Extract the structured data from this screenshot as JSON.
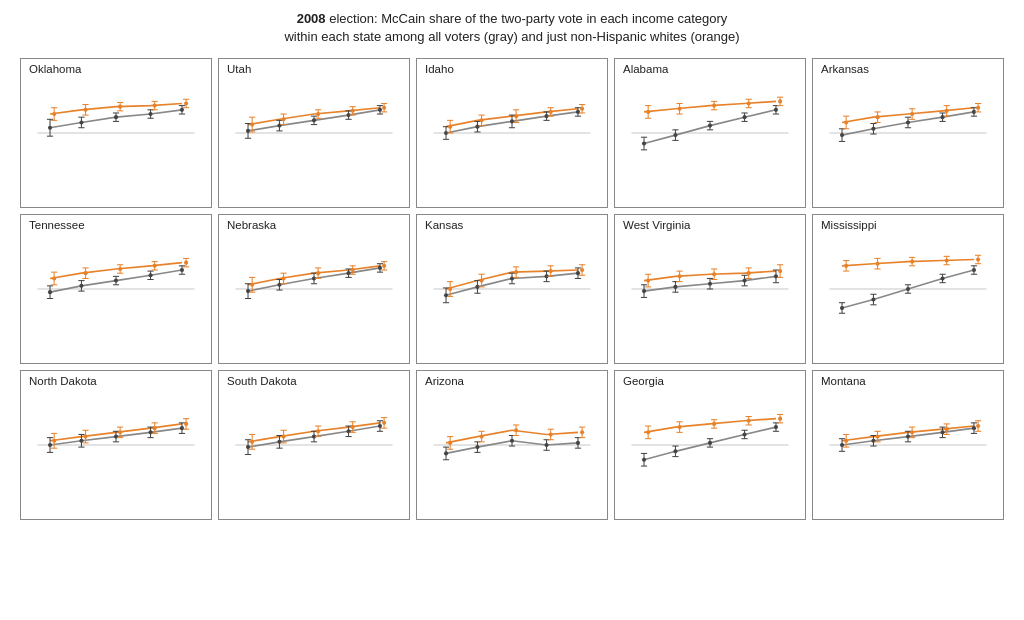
{
  "title": {
    "line1_bold": "2008",
    "line1_rest": " election:  McCain share of the two-party vote in each income category",
    "line2": "within each state among all voters (gray) and just non-Hispanic whites (orange)"
  },
  "charts": [
    {
      "name": "Oklahoma"
    },
    {
      "name": "Utah"
    },
    {
      "name": "Idaho"
    },
    {
      "name": "Alabama"
    },
    {
      "name": "Arkansas"
    },
    {
      "name": "Tennessee"
    },
    {
      "name": "Nebraska"
    },
    {
      "name": "Kansas"
    },
    {
      "name": "West Virginia"
    },
    {
      "name": "Mississippi"
    },
    {
      "name": "North Dakota"
    },
    {
      "name": "South Dakota"
    },
    {
      "name": "Arizona"
    },
    {
      "name": "Georgia"
    },
    {
      "name": "Montana"
    }
  ]
}
